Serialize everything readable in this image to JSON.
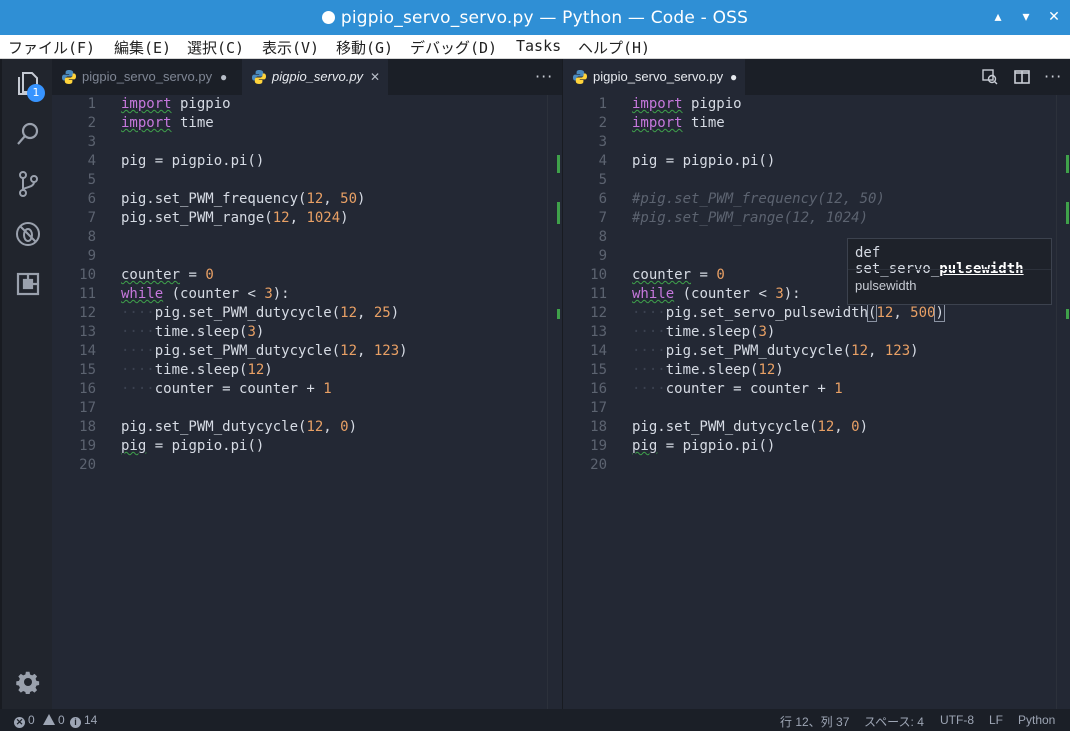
{
  "window": {
    "title": "pigpio_servo_servo.py — Python — Code - OSS",
    "controls": [
      "▴",
      "▾",
      "✕"
    ]
  },
  "menubar": [
    "ファイル(F)",
    "編集(E)",
    "選択(C)",
    "表示(V)",
    "移動(G)",
    "デバッグ(D)",
    "Tasks",
    "ヘルプ(H)"
  ],
  "activitybar": {
    "icons": [
      "files-icon",
      "search-icon",
      "source-control-icon",
      "debug-icon",
      "extensions-icon"
    ],
    "explorer_badge": "1",
    "settings_icon": "gear-icon"
  },
  "left_editor": {
    "tabs": [
      {
        "label": "pigpio_servo_servo.py",
        "state": "●",
        "active": false
      },
      {
        "label": "pigpio_servo.py",
        "state": "✕",
        "active": true
      }
    ],
    "more": "···",
    "lines": [
      "1",
      "2",
      "3",
      "4",
      "5",
      "6",
      "7",
      "8",
      "9",
      "10",
      "11",
      "12",
      "13",
      "14",
      "15",
      "16",
      "17",
      "18",
      "19",
      "20"
    ]
  },
  "right_editor": {
    "tabs": [
      {
        "label": "pigpio_servo_servo.py",
        "state": "●",
        "active": true
      }
    ],
    "more": "···",
    "tools": [
      "open-changes-icon",
      "split-editor-icon"
    ],
    "lines": [
      "1",
      "2",
      "3",
      "4",
      "5",
      "6",
      "7",
      "8",
      "9",
      "10",
      "11",
      "12",
      "13",
      "14",
      "15",
      "16",
      "17",
      "18",
      "19",
      "20"
    ]
  },
  "hover": {
    "signature_prefix": "def set_servo_",
    "signature_param": "pulsewidth",
    "doc": "pulsewidth"
  },
  "statusbar": {
    "errors": "0",
    "warnings": "0",
    "infos": "14",
    "position": "行 12、列 37",
    "indent": "スペース: 4",
    "encoding": "UTF-8",
    "eol": "LF",
    "language": "Python"
  },
  "colors": {
    "titlebar": "#2f8fd5",
    "keyword": "#c678dd",
    "number": "#e8a065",
    "editor_bg": "#232834",
    "badge": "#3794ff"
  }
}
